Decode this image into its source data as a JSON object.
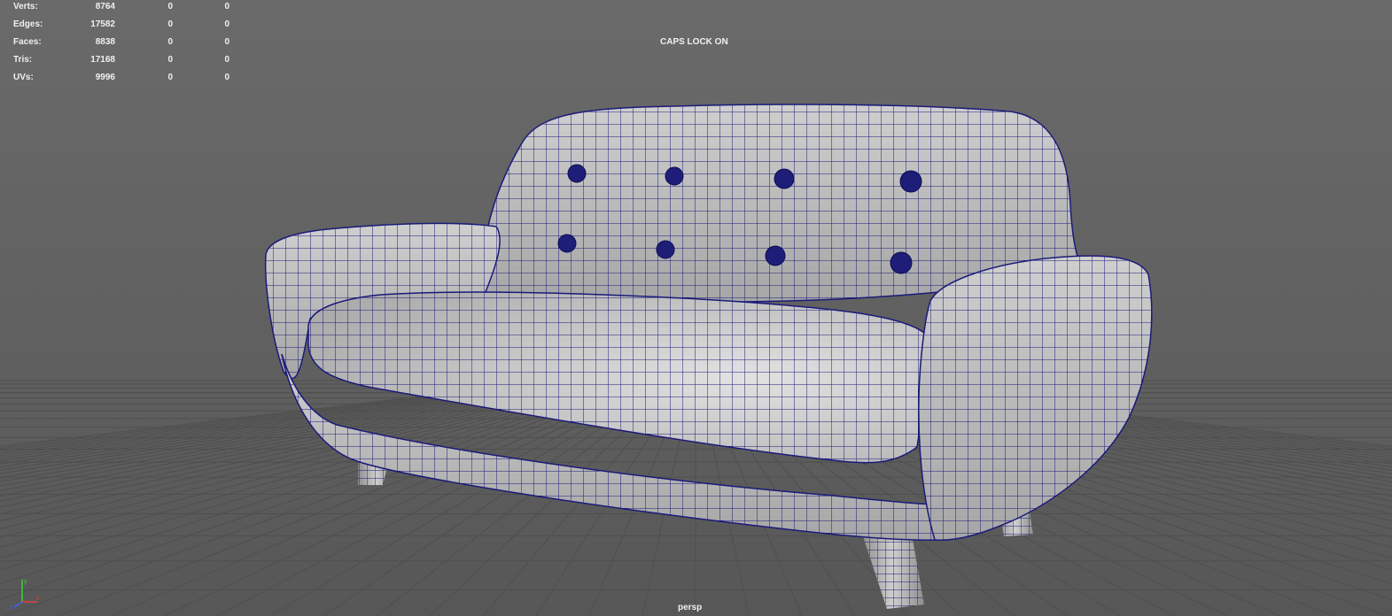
{
  "hud": {
    "rows": [
      {
        "label": "Verts:",
        "total": "8764",
        "selected": "0",
        "component": "0"
      },
      {
        "label": "Edges:",
        "total": "17582",
        "selected": "0",
        "component": "0"
      },
      {
        "label": "Faces:",
        "total": "8838",
        "selected": "0",
        "component": "0"
      },
      {
        "label": "Tris:",
        "total": "17168",
        "selected": "0",
        "component": "0"
      },
      {
        "label": "UVs:",
        "total": "9996",
        "selected": "0",
        "component": "0"
      }
    ]
  },
  "viewport": {
    "caps_lock_message": "CAPS LOCK ON",
    "camera_name": "persp",
    "background_color": "#636363",
    "grid_color": "#4c4c4c",
    "wireframe_color": "#1a1a7a",
    "mesh_color": "#b9b9b9"
  }
}
